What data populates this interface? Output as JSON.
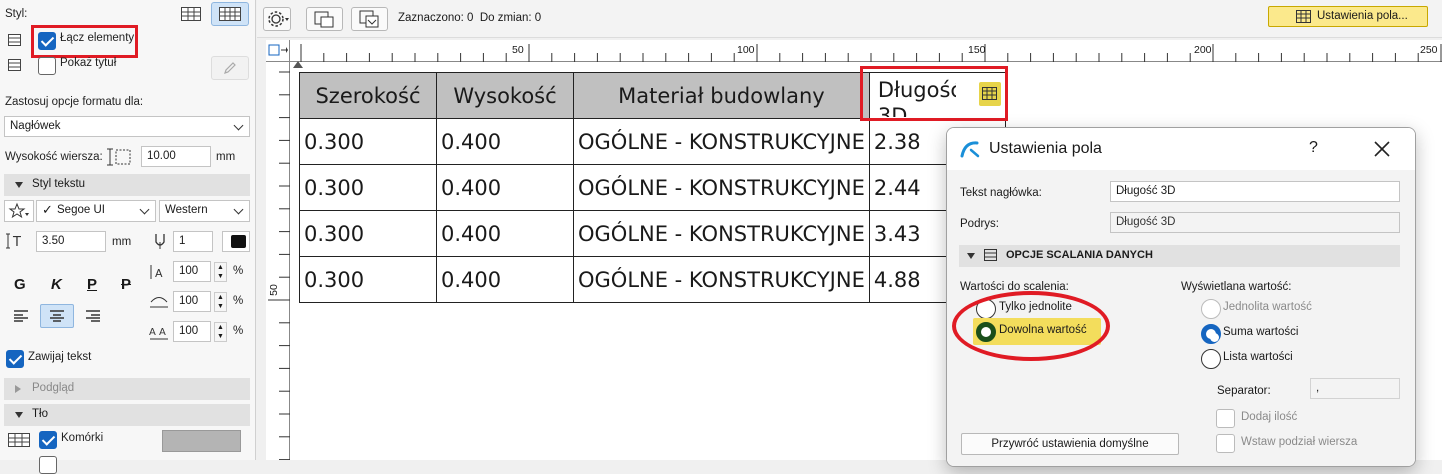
{
  "left_panel": {
    "style_label": "Styl:",
    "merge_elements_label": "Łącz elementy",
    "merge_elements_checked": true,
    "show_title_label": "Pokaż tytuł",
    "show_title_checked": false,
    "apply_format_label": "Zastosuj opcje formatu dla:",
    "apply_format_value": "Nagłówek",
    "row_height_label": "Wysokość wiersza:",
    "row_height_value": "10.00",
    "row_height_unit": "mm",
    "text_style_section": "Styl tekstu",
    "font_value": "Segoe UI",
    "script_value": "Western",
    "font_size_value": "3.50",
    "font_size_unit": "mm",
    "pen_value": "1",
    "bold_label": "G",
    "italic_label": "K",
    "underline_label": "P",
    "strike_label": "P",
    "spacing1_value": "100",
    "spacing2_value": "100",
    "spacing3_value": "100",
    "percent": "%",
    "wrap_text_label": "Zawijaj tekst",
    "wrap_text_checked": true,
    "preview_section": "Podgląd",
    "background_section": "Tło",
    "cells_label": "Komórki",
    "cells_checked": true,
    "cells_color": "#b4b4b4"
  },
  "toolbar": {
    "selection_status": "Zaznaczono: 0  Do zmian: 0",
    "field_settings_button": "Ustawienia pola...",
    "accent_color": "#fbe98c"
  },
  "ruler": {
    "h_labels": [
      "50",
      "100",
      "150",
      "200",
      "250"
    ],
    "v_labels": [
      "50"
    ]
  },
  "table": {
    "headers": [
      "Szerokość",
      "Wysokość",
      "Materiał budowlany",
      "Długość 3D"
    ],
    "rows": [
      [
        "0.300",
        "0.400",
        "OGÓLNE - KONSTRUKCYJNE",
        "2.38"
      ],
      [
        "0.300",
        "0.400",
        "OGÓLNE - KONSTRUKCYJNE",
        "2.44"
      ],
      [
        "0.300",
        "0.400",
        "OGÓLNE - KONSTRUKCYJNE",
        "3.43"
      ],
      [
        "0.300",
        "0.400",
        "OGÓLNE - KONSTRUKCYJNE",
        "4.88"
      ]
    ]
  },
  "dialog": {
    "title": "Ustawienia pola",
    "help": "?",
    "header_text_label": "Tekst nagłówka:",
    "header_text_value": "Długość 3D",
    "subheader_label": "Podrys:",
    "subheader_value": "Długość 3D",
    "section_title": "OPCJE SCALANIA DANYCH",
    "merge_values_label": "Wartości do scalenia:",
    "only_uniform_label": "Tylko jednolite",
    "any_value_label": "Dowolna wartość",
    "display_value_label": "Wyświetlana wartość:",
    "uniform_value_label": "Jednolita wartość",
    "sum_values_label": "Suma wartości",
    "list_values_label": "Lista wartości",
    "separator_label": "Separator:",
    "separator_value": ",",
    "add_count_label": "Dodaj ilość",
    "insert_row_break_label": "Wstaw podział wiersza",
    "restore_defaults_button": "Przywróć ustawienia domyślne",
    "highlight_color": "#f3dd5c",
    "annotation_color": "#e01b24"
  }
}
